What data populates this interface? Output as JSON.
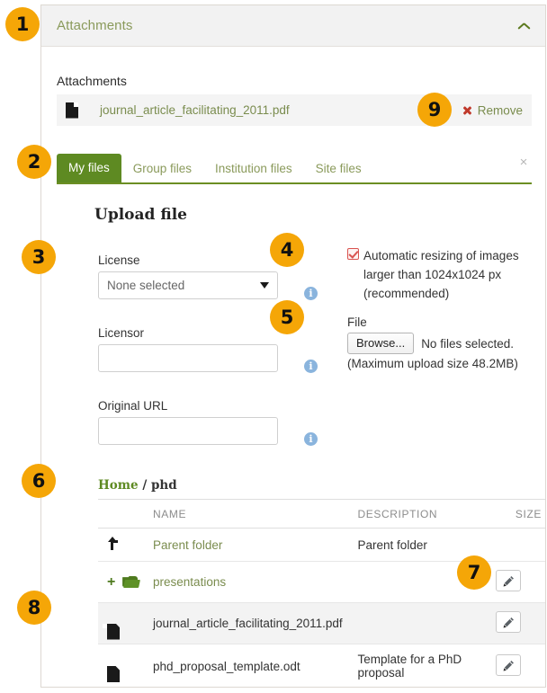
{
  "block": {
    "title": "Attachments",
    "collapse_icon": "chevron-up-icon"
  },
  "attachments": {
    "label": "Attachments",
    "items": [
      {
        "icon": "file-icon",
        "name": "journal_article_facilitating_2011.pdf",
        "remove_label": "Remove",
        "remove_icon": "remove-x-icon"
      }
    ]
  },
  "tabs": {
    "items": [
      {
        "label": "My files",
        "active": true
      },
      {
        "label": "Group files",
        "active": false
      },
      {
        "label": "Institution files",
        "active": false
      },
      {
        "label": "Site files",
        "active": false
      }
    ],
    "close_icon": "close-icon",
    "close_label": "×"
  },
  "upload": {
    "heading": "Upload file",
    "license": {
      "label": "License",
      "value": "None selected",
      "options": [
        "None selected"
      ],
      "caret_icon": "caret-down-icon",
      "info_icon": "info-icon"
    },
    "licensor": {
      "label": "Licensor",
      "value": "",
      "placeholder": "",
      "info_icon": "info-icon"
    },
    "original_url": {
      "label": "Original URL",
      "value": "",
      "placeholder": "",
      "info_icon": "info-icon"
    },
    "resize": {
      "checked": true,
      "label": "Automatic resizing of images larger than 1024x1024 px (recommended)",
      "info_icon": "info-icon",
      "checkbox_icon": "checkbox-checked-icon"
    },
    "file": {
      "label": "File",
      "browse_label": "Browse...",
      "status": "No files selected.",
      "max_size_note": "(Maximum upload size 48.2MB)",
      "info_icon": "info-icon"
    }
  },
  "breadcrumb": {
    "home": "Home",
    "separator": "/",
    "current": "phd"
  },
  "file_table": {
    "columns": [
      "NAME",
      "DESCRIPTION",
      "SIZE"
    ],
    "rows": [
      {
        "icon": "up-arrow-icon",
        "name": "Parent folder",
        "description": "Parent folder",
        "size": "",
        "is_link": true,
        "highlight": false,
        "has_edit": false,
        "has_plus": false
      },
      {
        "icon": "folder-icon",
        "name": "presentations",
        "description": "",
        "size": "",
        "is_link": true,
        "highlight": false,
        "has_edit": true,
        "has_plus": true,
        "plus_icon": "plus-icon"
      },
      {
        "icon": "file-icon",
        "name": "journal_article_facilitating_2011.pdf",
        "description": "",
        "size": "",
        "is_link": false,
        "highlight": true,
        "has_edit": true,
        "has_plus": false
      },
      {
        "icon": "file-icon",
        "name": "phd_proposal_template.odt",
        "description": "Template for a PhD proposal",
        "size": "",
        "is_link": false,
        "highlight": false,
        "has_edit": true,
        "has_plus": false
      }
    ],
    "edit_icon": "pencil-icon"
  },
  "callouts": [
    {
      "id": "1",
      "number": "1"
    },
    {
      "id": "2",
      "number": "2"
    },
    {
      "id": "3",
      "number": "3"
    },
    {
      "id": "4",
      "number": "4"
    },
    {
      "id": "5",
      "number": "5"
    },
    {
      "id": "6",
      "number": "6"
    },
    {
      "id": "7",
      "number": "7"
    },
    {
      "id": "8",
      "number": "8"
    },
    {
      "id": "9",
      "number": "9"
    }
  ],
  "colors": {
    "badge": "#f5a607",
    "tab_active_bg": "#5e8a22",
    "tab_underline": "#6b8e23",
    "link_green": "#7a8c4e",
    "header_bg": "#f2f2f2",
    "info_blue": "#8ab4dd",
    "remove_red": "#c0392b"
  }
}
